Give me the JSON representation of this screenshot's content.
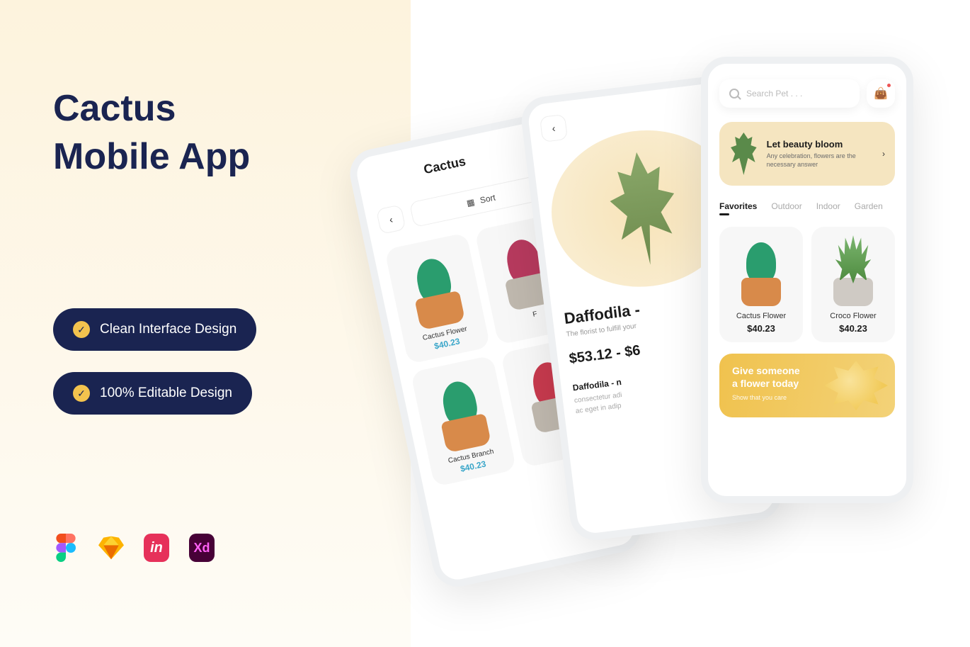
{
  "promo": {
    "title_line1": "Cactus",
    "title_line2": "Mobile App",
    "pill1": "Clean Interface Design",
    "pill2": "100% Editable Design"
  },
  "tools": [
    "Figma",
    "Sketch",
    "InVision",
    "Adobe XD"
  ],
  "phone1": {
    "title": "Cactus",
    "sort": "Sort",
    "items": [
      {
        "name": "Cactus Flower",
        "price": "$40.23"
      },
      {
        "name": "F",
        "price": ""
      },
      {
        "name": "Cactus Branch",
        "price": "$40.23"
      },
      {
        "name": "",
        "price": ""
      }
    ]
  },
  "phone2": {
    "title": "Daffodila -",
    "subtitle": "The florist to fulfill your",
    "price": "$53.12 - $6",
    "section_heading": "Daffodila - n",
    "body1": "consectetur adi",
    "body2": "ac eget in adip"
  },
  "phone3": {
    "search_placeholder": "Search Pet . . .",
    "banner1": {
      "title": "Let beauty bloom",
      "subtitle": "Any celebration, flowers are the necessary answer"
    },
    "tabs": [
      "Favorites",
      "Outdoor",
      "Indoor",
      "Garden"
    ],
    "active_tab": 0,
    "cards": [
      {
        "name": "Cactus Flower",
        "price": "$40.23"
      },
      {
        "name": "Croco Flower",
        "price": "$40.23"
      }
    ],
    "banner2": {
      "title_line1": "Give someone",
      "title_line2": "a flower today",
      "subtitle": "Show that you care"
    }
  }
}
